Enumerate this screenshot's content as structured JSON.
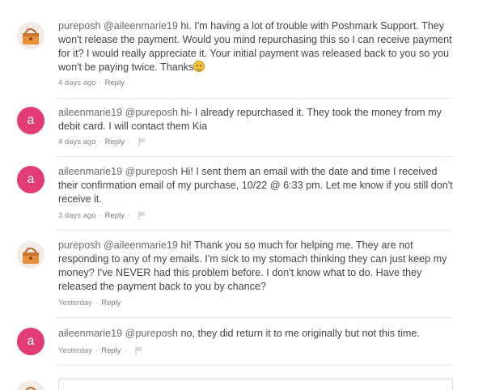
{
  "comments": [
    {
      "username": "pureposh",
      "mention": "@aileenmarie19",
      "text": "hi. I'm having a lot of trouble with Poshmark Support. They won't release the payment. Would you mind repurchasing this so I can receive payment for it? I would really appreciate it. Your initial payment was released back to you so you won't be paying twice. Thanks",
      "emoji": "smiling-face-emoji",
      "time": "4 days ago",
      "reply": "Reply",
      "avatar": "handbag-avatar",
      "has_flag": false
    },
    {
      "username": "aileenmarie19",
      "mention": "@pureposh",
      "text": "hi- I already repurchased it. They took the money from my debit card. I will contact them Kia",
      "time": "4 days ago",
      "reply": "Reply",
      "avatar_letter": "a",
      "has_flag": true
    },
    {
      "username": "aileenmarie19",
      "mention": "@pureposh",
      "text": "Hi! I sent them an email with the date and time I received their confirmation email of my purchase, 10/22 @ 6:33 pm. Let me know if you still don't receive it.",
      "time": "3 days ago",
      "reply": "Reply",
      "avatar_letter": "a",
      "has_flag": true
    },
    {
      "username": "pureposh",
      "mention": "@aileenmarie19",
      "text": "hi! Thank you so much for helping me. They are not responding to any of my emails. I'm sick to my stomach thinking they can just keep my money? I've NEVER had this problem before. I don't know what to do. Have they released the payment back to you by chance?",
      "time": "Yesterday",
      "reply": "Reply",
      "avatar": "handbag-avatar",
      "has_flag": false
    },
    {
      "username": "aileenmarie19",
      "mention": "@pureposh",
      "text": "no, they did return it to me originally but not this time.",
      "time": "Yesterday",
      "reply": "Reply",
      "avatar_letter": "a",
      "has_flag": true
    }
  ],
  "separator": "·",
  "colors": {
    "avatar_pink": "#e23b76",
    "text": "#444444",
    "meta": "#8a8a8a",
    "divider": "#e6e6e6"
  }
}
